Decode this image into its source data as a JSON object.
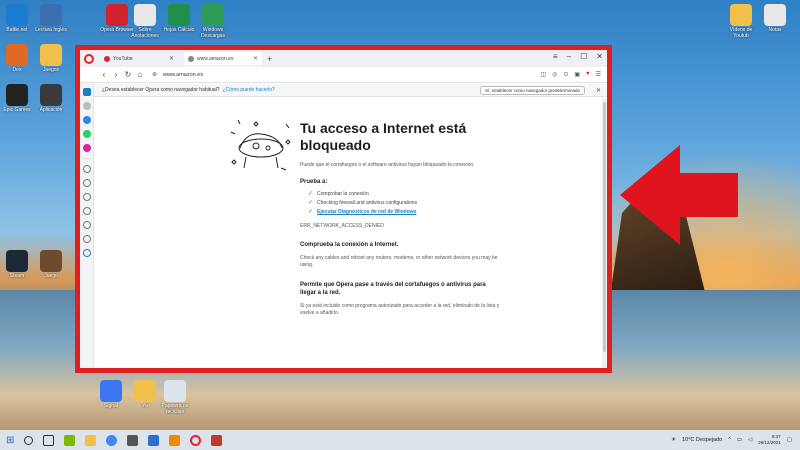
{
  "desktop": {
    "icons_left": [
      {
        "label": "Battle.net",
        "icon": "battlenet-icon",
        "color": "#1a7bd1"
      },
      {
        "label": "Lectura Inglés",
        "icon": "user-icon",
        "color": "#3c6fb0"
      },
      {
        "label": "Opera Browser",
        "icon": "opera-icon",
        "color": "#d1222e"
      },
      {
        "label": "Sobre Anotaciones",
        "icon": "document-icon",
        "color": "#e8e8e8"
      },
      {
        "label": "Hojas Cálculo",
        "icon": "spreadsheet-icon",
        "color": "#1f8f4b"
      },
      {
        "label": "Windows Descargas",
        "icon": "excel-icon",
        "color": "#2e9b58"
      },
      {
        "label": "Dex",
        "icon": "dex-icon",
        "color": "#e06a23"
      },
      {
        "label": "Juegos",
        "icon": "folder-icon",
        "color": "#f1c04a"
      },
      {
        "label": "Epic Games",
        "icon": "epic-icon",
        "color": "#222222"
      },
      {
        "label": "Aplicación",
        "icon": "app-icon",
        "color": "#3a3a3a"
      },
      {
        "label": "Steam",
        "icon": "steam-icon",
        "color": "#1b2838"
      },
      {
        "label": "Juego",
        "icon": "game-icon",
        "color": "#6e4a2f"
      }
    ],
    "icons_right": [
      {
        "label": "Vídeos de Youtub",
        "icon": "folder-icon",
        "color": "#f1c04a"
      },
      {
        "label": "Notas",
        "icon": "document-icon",
        "color": "#e8e8e8"
      }
    ],
    "icons_bottom": [
      {
        "label": "Signal",
        "icon": "signal-icon",
        "color": "#3a76f0"
      },
      {
        "label": "Yo",
        "icon": "folder-icon",
        "color": "#f1c04a"
      },
      {
        "label": "Papelera de reciclaje",
        "icon": "recycle-bin-icon",
        "color": "#d9e4ee"
      }
    ]
  },
  "browser": {
    "tabs": [
      {
        "label": "YouTube",
        "favicon_color": "#e0232e",
        "active": false
      },
      {
        "label": "www.amazon.es",
        "favicon_color": "#888888",
        "active": true
      }
    ],
    "url": "www.amazon.es",
    "infobar": {
      "question": "¿Desea establecer Opera como navegador habitual?",
      "link": "¿Cómo puedo hacerlo?",
      "button": "Sí, establecer como navegador predeterminado"
    },
    "error": {
      "title": "Tu acceso a Internet está bloqueado",
      "description": "Puede que el cortafuegos o el software antivirus hayan bloqueado la conexión.",
      "try_title": "Prueba a:",
      "try_items": [
        "Comprobar la conexión",
        "Checking firewall and antivirus configurations",
        "Ejecutar Diagnósticos de red de Windows"
      ],
      "code": "ERR_NETWORK_ACCESS_DENIED",
      "section1_title": "Comprueba la conexión a Internet.",
      "section1_text": "Check any cables and reboot any routers, modems, or other network devices you may be using.",
      "section2_title": "Permite que Opera pase a través del cortafuegos o antivirus para llegar a la red.",
      "section2_text": "Si ya está incluido como programa autorizado para acceder a la red, elimínalo de la lista y vuelve a añadirlo."
    }
  },
  "taskbar": {
    "weather": "10°C Despejado",
    "time": "8:37",
    "date": "26/12/2021"
  },
  "colors": {
    "highlight": "#e02020",
    "opera_red": "#e0232e",
    "link": "#1b7fc1"
  }
}
